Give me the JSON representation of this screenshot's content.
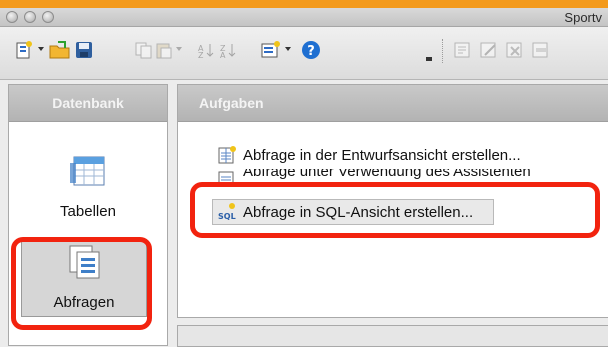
{
  "window": {
    "title": "Sportv"
  },
  "toolbar": {
    "items": [
      {
        "icon": "new-document-icon",
        "has_dropdown": true,
        "enabled": true
      },
      {
        "icon": "open-folder-icon",
        "enabled": true
      },
      {
        "icon": "save-icon",
        "enabled": true
      },
      {
        "icon": "copy-icon",
        "enabled": false
      },
      {
        "icon": "paste-icon",
        "has_dropdown": true,
        "enabled": false
      },
      {
        "icon": "sort-ascending-icon",
        "enabled": false
      },
      {
        "icon": "sort-descending-icon",
        "enabled": false
      },
      {
        "icon": "form-icon",
        "has_dropdown": true,
        "enabled": true
      },
      {
        "icon": "help-icon",
        "enabled": true
      },
      {
        "icon": "open-object-icon",
        "enabled": false
      },
      {
        "icon": "edit-object-icon",
        "enabled": false
      },
      {
        "icon": "delete-object-icon",
        "enabled": false
      },
      {
        "icon": "rename-object-icon",
        "enabled": false
      }
    ]
  },
  "sidebar": {
    "header": "Datenbank",
    "items": [
      {
        "label": "Tabellen",
        "icon": "table-icon",
        "selected": false
      },
      {
        "label": "Abfragen",
        "icon": "query-icon",
        "selected": true
      }
    ]
  },
  "tasks": {
    "header": "Aufgaben",
    "items": [
      {
        "label": "Abfrage in der Entwurfsansicht erstellen...",
        "icon": "design-view-icon"
      },
      {
        "label": "Abfrage unter Verwendung des Assistenten",
        "icon": "wizard-icon"
      },
      {
        "label": "Abfrage in SQL-Ansicht erstellen...",
        "icon": "sql-icon",
        "icon_text": "SQL",
        "selected": true
      }
    ]
  },
  "annotations": {
    "highlight_color": "#f2230f"
  },
  "colors": {
    "accent_strip": "#f39a1c",
    "help_blue": "#1f6fd1"
  }
}
